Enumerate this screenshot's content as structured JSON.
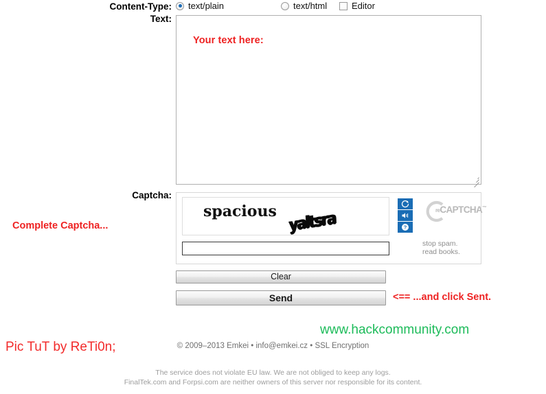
{
  "form": {
    "content_type": {
      "label": "Content-Type:",
      "options": [
        {
          "label": "text/plain",
          "type": "radio",
          "checked": true
        },
        {
          "label": "text/html",
          "type": "radio",
          "checked": false
        },
        {
          "label": "Editor",
          "type": "checkbox",
          "checked": false
        }
      ]
    },
    "text": {
      "label": "Text:",
      "value": "Your text here:",
      "placeholder": ""
    },
    "captcha": {
      "label": "Captcha:",
      "word_1": "spacious",
      "word_2": "yaltsra",
      "input_value": "",
      "input_placeholder": "",
      "controls": [
        {
          "name": "refresh",
          "title": "Get a new challenge"
        },
        {
          "name": "audio",
          "title": "Get an audio challenge"
        },
        {
          "name": "help",
          "title": "Help"
        }
      ],
      "logo_prefix": "re",
      "logo_main": "CAPTCHA",
      "logo_tm": "™",
      "tagline_line_1": "stop spam.",
      "tagline_line_2": "read books."
    },
    "buttons": {
      "clear": "Clear",
      "send": "Send"
    }
  },
  "annotations": {
    "text_hint": "Your text here:",
    "captcha_hint": "Complete Captcha...",
    "send_hint": "<== ...and click Sent.",
    "credit": "Pic TuT by ReTi0n;",
    "site": "www.hackcommunity.com"
  },
  "footer": {
    "copyright": "© 2009–2013 Emkei • info@emkei.cz • SSL Encryption",
    "disclaimer_line_1": "The service does not violate EU law. We are not obliged to keep any logs.",
    "disclaimer_line_2": "FinalTek.com and Forpsi.com are neither owners of this server nor responsible for its content."
  },
  "colors": {
    "annotation_red": "#ee2222",
    "credit_red": "#f22b2b",
    "site_green": "#1dbb5a",
    "recaptcha_blue": "#1a6db5",
    "footer_gray": "#6f6f6f"
  }
}
